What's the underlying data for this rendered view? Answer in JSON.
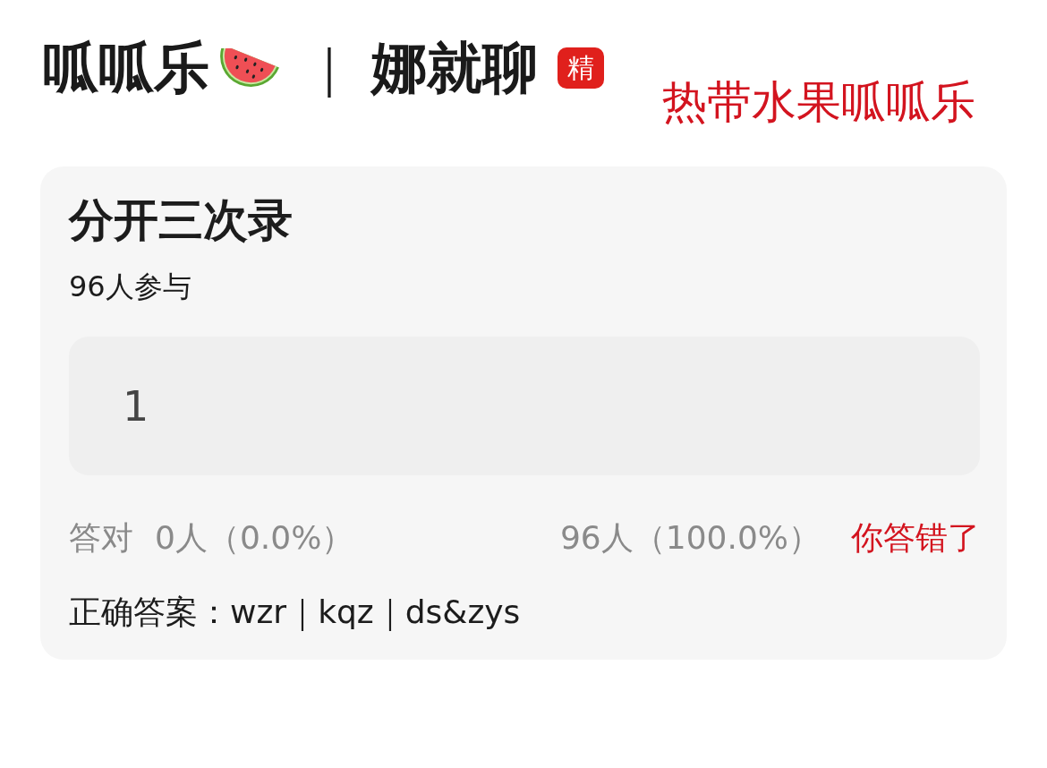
{
  "header": {
    "title": "呱呱乐",
    "separator": "｜",
    "channel": "娜就聊",
    "badge": "精"
  },
  "annotation": "热带水果呱呱乐",
  "quiz": {
    "title": "分开三次录",
    "participants": "96人参与",
    "answer": {
      "value": "1"
    },
    "stats": {
      "correct_label": "答对",
      "correct_count": "0人（0.0%）",
      "wrong_count": "96人（100.0%）",
      "result": {
        "text": "你答错了",
        "correct": false
      }
    },
    "correct_answer": "正确答案：wzr｜kqz｜ds&zys"
  }
}
